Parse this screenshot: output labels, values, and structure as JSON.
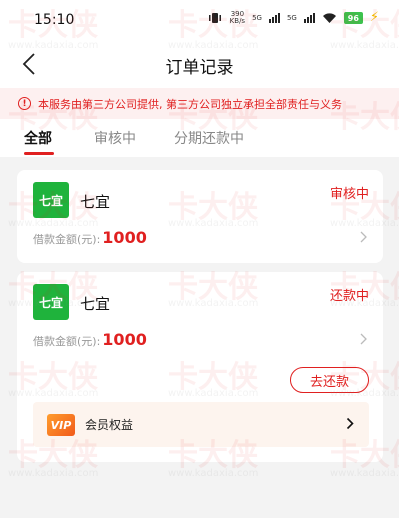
{
  "status_bar": {
    "time": "15:10",
    "net_speed": "390",
    "net_unit": "KB/s",
    "sig1": "5G",
    "sig2": "5G",
    "battery": "96"
  },
  "nav": {
    "title": "订单记录"
  },
  "notice": {
    "text": "本服务由第三方公司提供, 第三方公司独立承担全部责任与义务"
  },
  "tabs": [
    {
      "label": "全部"
    },
    {
      "label": "审核中"
    },
    {
      "label": "分期还款中"
    }
  ],
  "orders": [
    {
      "logo_text": "七宜",
      "lender": "七宜",
      "status": "审核中",
      "amount_label": "借款金额(元):",
      "amount": "1000"
    },
    {
      "logo_text": "七宜",
      "lender": "七宜",
      "status": "还款中",
      "amount_label": "借款金额(元):",
      "amount": "1000",
      "action": "去还款",
      "vip_badge": "VIP",
      "vip_label": "会员权益"
    }
  ],
  "watermark": {
    "brand": "卡大侠",
    "url": "www.kadaxia.com"
  },
  "colors": {
    "accent": "#e02020",
    "logo_green": "#1fb33c",
    "battery_green": "#3cc24d"
  }
}
